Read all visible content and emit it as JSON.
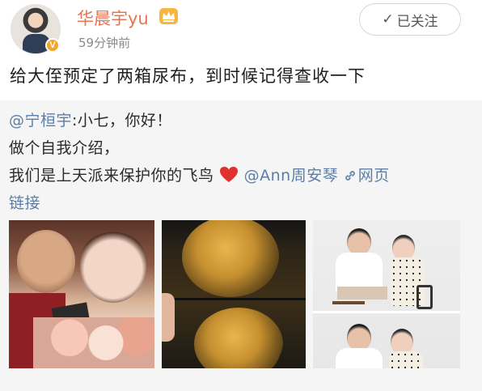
{
  "header": {
    "username": "华晨宇yu",
    "timestamp": "59分钟前",
    "follow_label": "已关注",
    "follow_icon": "✓",
    "verified_icon": "V"
  },
  "post": {
    "text": "给大侄预定了两箱尿布，到时候记得查收一下"
  },
  "repost": {
    "line1_mention": "@宁桓宇",
    "line1_text": ":小七，你好！",
    "line2_text": "做个自我介绍，",
    "line3_text": "我们是上天派来保护你的飞鸟",
    "line3_mention": "@Ann周安琴",
    "line3_link": "网页",
    "line4_link": "链接",
    "colors": {
      "mention": "#5b7ea8",
      "heart": "#e0312f"
    }
  },
  "colors": {
    "username": "#eb7350",
    "vip_badge": "#f6b73c"
  }
}
